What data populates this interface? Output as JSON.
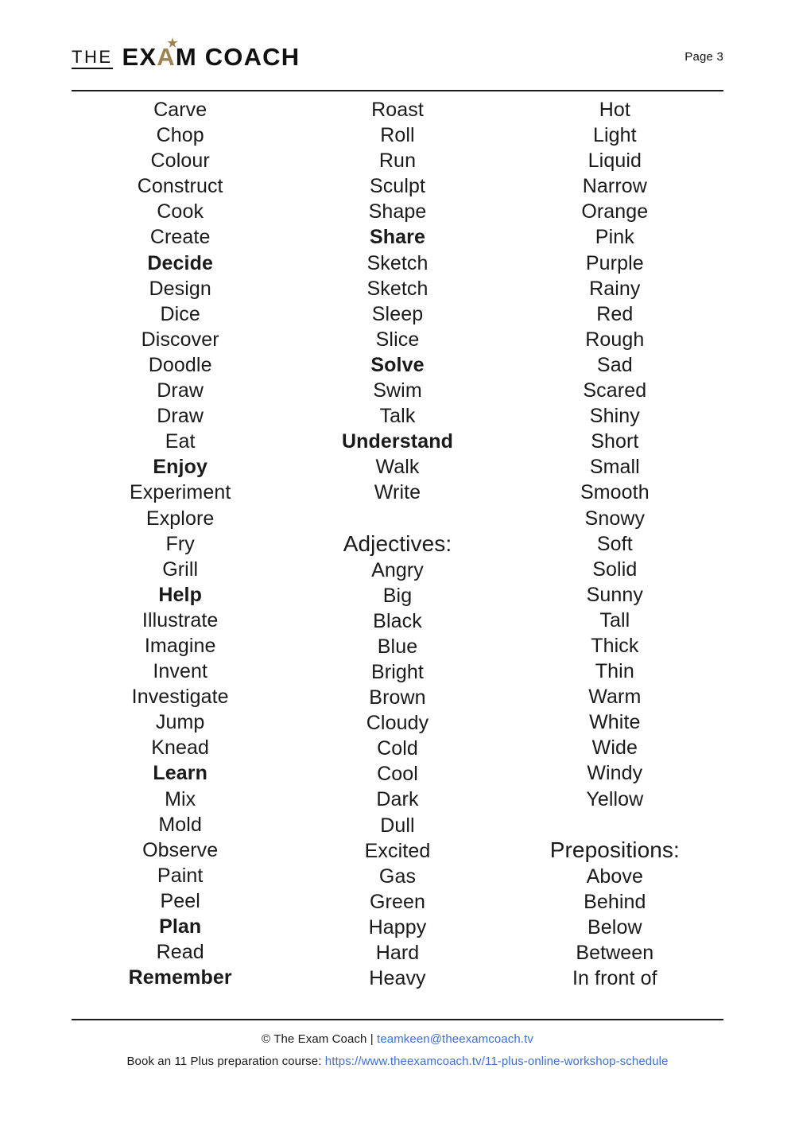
{
  "header": {
    "logo_the": "THE",
    "logo_ex": "EX",
    "logo_a": "A",
    "logo_star": "★",
    "logo_rest": "M COACH",
    "page_number": "Page 3",
    "accent_color": "#9d8350"
  },
  "columns": [
    {
      "name": "column-1",
      "entries": [
        {
          "text": "Carve",
          "bold": false
        },
        {
          "text": "Chop",
          "bold": false
        },
        {
          "text": "Colour",
          "bold": false
        },
        {
          "text": "Construct",
          "bold": false
        },
        {
          "text": "Cook",
          "bold": false
        },
        {
          "text": "Create",
          "bold": false
        },
        {
          "text": "Decide",
          "bold": true
        },
        {
          "text": "Design",
          "bold": false
        },
        {
          "text": "Dice",
          "bold": false
        },
        {
          "text": "Discover",
          "bold": false
        },
        {
          "text": "Doodle",
          "bold": false
        },
        {
          "text": "Draw",
          "bold": false
        },
        {
          "text": "Draw",
          "bold": false
        },
        {
          "text": "Eat",
          "bold": false
        },
        {
          "text": "Enjoy",
          "bold": true
        },
        {
          "text": "Experiment",
          "bold": false
        },
        {
          "text": "Explore",
          "bold": false
        },
        {
          "text": "Fry",
          "bold": false
        },
        {
          "text": "Grill",
          "bold": false
        },
        {
          "text": "Help",
          "bold": true
        },
        {
          "text": "Illustrate",
          "bold": false
        },
        {
          "text": "Imagine",
          "bold": false
        },
        {
          "text": "Invent",
          "bold": false
        },
        {
          "text": "Investigate",
          "bold": false
        },
        {
          "text": "Jump",
          "bold": false
        },
        {
          "text": "Knead",
          "bold": false
        },
        {
          "text": "Learn",
          "bold": true
        },
        {
          "text": "Mix",
          "bold": false
        },
        {
          "text": "Mold",
          "bold": false
        },
        {
          "text": "Observe",
          "bold": false
        },
        {
          "text": "Paint",
          "bold": false
        },
        {
          "text": "Peel",
          "bold": false
        },
        {
          "text": "Plan",
          "bold": true
        },
        {
          "text": "Read",
          "bold": false
        },
        {
          "text": "Remember",
          "bold": true
        }
      ]
    },
    {
      "name": "column-2",
      "entries": [
        {
          "text": "Roast",
          "bold": false
        },
        {
          "text": "Roll",
          "bold": false
        },
        {
          "text": "Run",
          "bold": false
        },
        {
          "text": "Sculpt",
          "bold": false
        },
        {
          "text": "Shape",
          "bold": false
        },
        {
          "text": "Share",
          "bold": true
        },
        {
          "text": "Sketch",
          "bold": false
        },
        {
          "text": "Sketch",
          "bold": false
        },
        {
          "text": "Sleep",
          "bold": false
        },
        {
          "text": "Slice",
          "bold": false
        },
        {
          "text": "Solve",
          "bold": true
        },
        {
          "text": "Swim",
          "bold": false
        },
        {
          "text": "Talk",
          "bold": false
        },
        {
          "text": "Understand",
          "bold": true
        },
        {
          "text": "Walk",
          "bold": false
        },
        {
          "text": "Write",
          "bold": false
        },
        {
          "text": "Adjectives:",
          "heading": true
        },
        {
          "text": "Angry",
          "bold": false
        },
        {
          "text": "Big",
          "bold": false
        },
        {
          "text": "Black",
          "bold": false
        },
        {
          "text": "Blue",
          "bold": false
        },
        {
          "text": "Bright",
          "bold": false
        },
        {
          "text": "Brown",
          "bold": false
        },
        {
          "text": "Cloudy",
          "bold": false
        },
        {
          "text": "Cold",
          "bold": false
        },
        {
          "text": "Cool",
          "bold": false
        },
        {
          "text": "Dark",
          "bold": false
        },
        {
          "text": "Dull",
          "bold": false
        },
        {
          "text": "Excited",
          "bold": false
        },
        {
          "text": "Gas",
          "bold": false
        },
        {
          "text": "Green",
          "bold": false
        },
        {
          "text": "Happy",
          "bold": false
        },
        {
          "text": "Hard",
          "bold": false
        },
        {
          "text": "Heavy",
          "bold": false
        }
      ]
    },
    {
      "name": "column-3",
      "entries": [
        {
          "text": "Hot",
          "bold": false
        },
        {
          "text": "Light",
          "bold": false
        },
        {
          "text": "Liquid",
          "bold": false
        },
        {
          "text": "Narrow",
          "bold": false
        },
        {
          "text": "Orange",
          "bold": false
        },
        {
          "text": "Pink",
          "bold": false
        },
        {
          "text": "Purple",
          "bold": false
        },
        {
          "text": "Rainy",
          "bold": false
        },
        {
          "text": "Red",
          "bold": false
        },
        {
          "text": "Rough",
          "bold": false
        },
        {
          "text": "Sad",
          "bold": false
        },
        {
          "text": "Scared",
          "bold": false
        },
        {
          "text": "Shiny",
          "bold": false
        },
        {
          "text": "Short",
          "bold": false
        },
        {
          "text": "Small",
          "bold": false
        },
        {
          "text": "Smooth",
          "bold": false
        },
        {
          "text": "Snowy",
          "bold": false
        },
        {
          "text": "Soft",
          "bold": false
        },
        {
          "text": "Solid",
          "bold": false
        },
        {
          "text": "Sunny",
          "bold": false
        },
        {
          "text": "Tall",
          "bold": false
        },
        {
          "text": "Thick",
          "bold": false
        },
        {
          "text": "Thin",
          "bold": false
        },
        {
          "text": "Warm",
          "bold": false
        },
        {
          "text": "White",
          "bold": false
        },
        {
          "text": "Wide",
          "bold": false
        },
        {
          "text": "Windy",
          "bold": false
        },
        {
          "text": "Yellow",
          "bold": false
        },
        {
          "text": "Prepositions:",
          "heading": true
        },
        {
          "text": "Above",
          "bold": false
        },
        {
          "text": "Behind",
          "bold": false
        },
        {
          "text": "Below",
          "bold": false
        },
        {
          "text": "Between",
          "bold": false
        },
        {
          "text": "In front of",
          "bold": false
        }
      ]
    }
  ],
  "footer": {
    "copyright": "© The Exam Coach",
    "separator": "|",
    "email": "teamkeen@theexamcoach.tv",
    "course_label": "Book an 11 Plus preparation course:",
    "course_url": "https://www.theexamcoach.tv/11-plus-online-workshop-schedule",
    "link_color": "#3d6fd6"
  }
}
